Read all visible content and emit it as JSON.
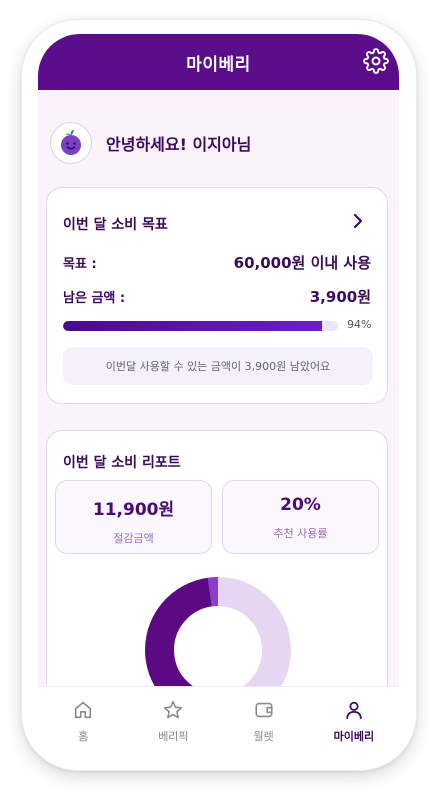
{
  "header": {
    "title": "마이베리"
  },
  "greeting": {
    "text": "안녕하세요!  이지아님"
  },
  "goal": {
    "title": "이번 달 소비 목표",
    "target_label": "목표 :",
    "target_value": "60,000원 이내 사용",
    "remaining_label": "남은 금액 :",
    "remaining_value": "3,900원",
    "progress_percent": 94,
    "progress_text": "94%",
    "notice": "이번달 사용할 수 있는 금액이 3,900원 남았어요"
  },
  "report": {
    "title": "이번 달 소비 리포트",
    "saved_amount": "11,900원",
    "saved_caption": "절감금액",
    "recommended_rate": "20%",
    "recommended_caption": "추천 사용률"
  },
  "colors": {
    "brand": "#5a0e8c",
    "donut_dark": "#5c0a84",
    "donut_mid": "#8a3fc9",
    "donut_light": "#e6d6f1"
  },
  "tabs": [
    {
      "label": "홈",
      "icon": "home-icon"
    },
    {
      "label": "베리픽",
      "icon": "star-icon"
    },
    {
      "label": "월렛",
      "icon": "wallet-icon"
    },
    {
      "label": "마이베리",
      "icon": "user-icon",
      "active": true
    }
  ]
}
